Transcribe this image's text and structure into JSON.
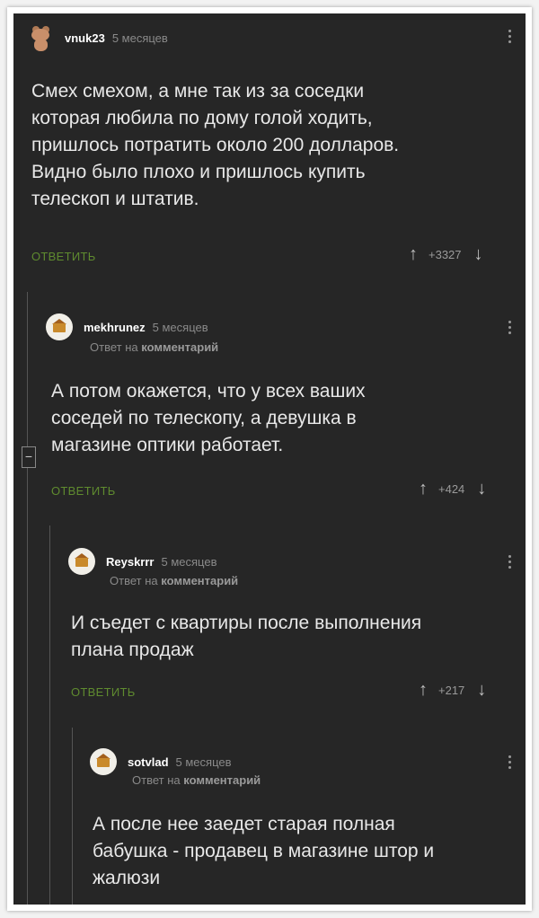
{
  "comments": [
    {
      "username": "vnuk23",
      "time": "5 месяцев",
      "reply_to": null,
      "text": [
        "Смех смехом, а мне так из за соседки",
        "которая любила по дому голой ходить,",
        "пришлось потратить около 200 долларов.",
        "Видно было плохо и пришлось купить",
        "телескоп и штатив."
      ],
      "reply_label": "ОТВЕТИТЬ",
      "votes": "+3327",
      "avatar": "bear-avatar"
    },
    {
      "username": "mekhrunez",
      "time": "5 месяцев",
      "reply_to_prefix": "Ответ на",
      "reply_to_link": "комментарий",
      "text": [
        "А потом окажется, что у всех ваших",
        "соседей по телескопу, а девушка в",
        "магазине оптики работает."
      ],
      "reply_label": "ОТВЕТИТЬ",
      "votes": "+424",
      "avatar": "house-avatar"
    },
    {
      "username": "Reyskrrr",
      "time": "5 месяцев",
      "reply_to_prefix": "Ответ на",
      "reply_to_link": "комментарий",
      "text": [
        "И съедет с квартиры после выполнения",
        "плана продаж"
      ],
      "reply_label": "ОТВЕТИТЬ",
      "votes": "+217",
      "avatar": "house-avatar"
    },
    {
      "username": "sotvlad",
      "time": "5 месяцев",
      "reply_to_prefix": "Ответ на",
      "reply_to_link": "комментарий",
      "text": [
        "А после нее заедет старая полная",
        "бабушка - продавец в магазине штор и",
        "жалюзи"
      ],
      "avatar": "house-avatar"
    }
  ],
  "collapse_symbol": "−",
  "icons": {
    "upvote": "↑",
    "downvote": "↓",
    "more": "more-vertical-icon"
  },
  "colors": {
    "background": "#262626",
    "reply": "#5f8b2f",
    "text": "#e8e8e8",
    "muted": "#8a8a8a"
  }
}
